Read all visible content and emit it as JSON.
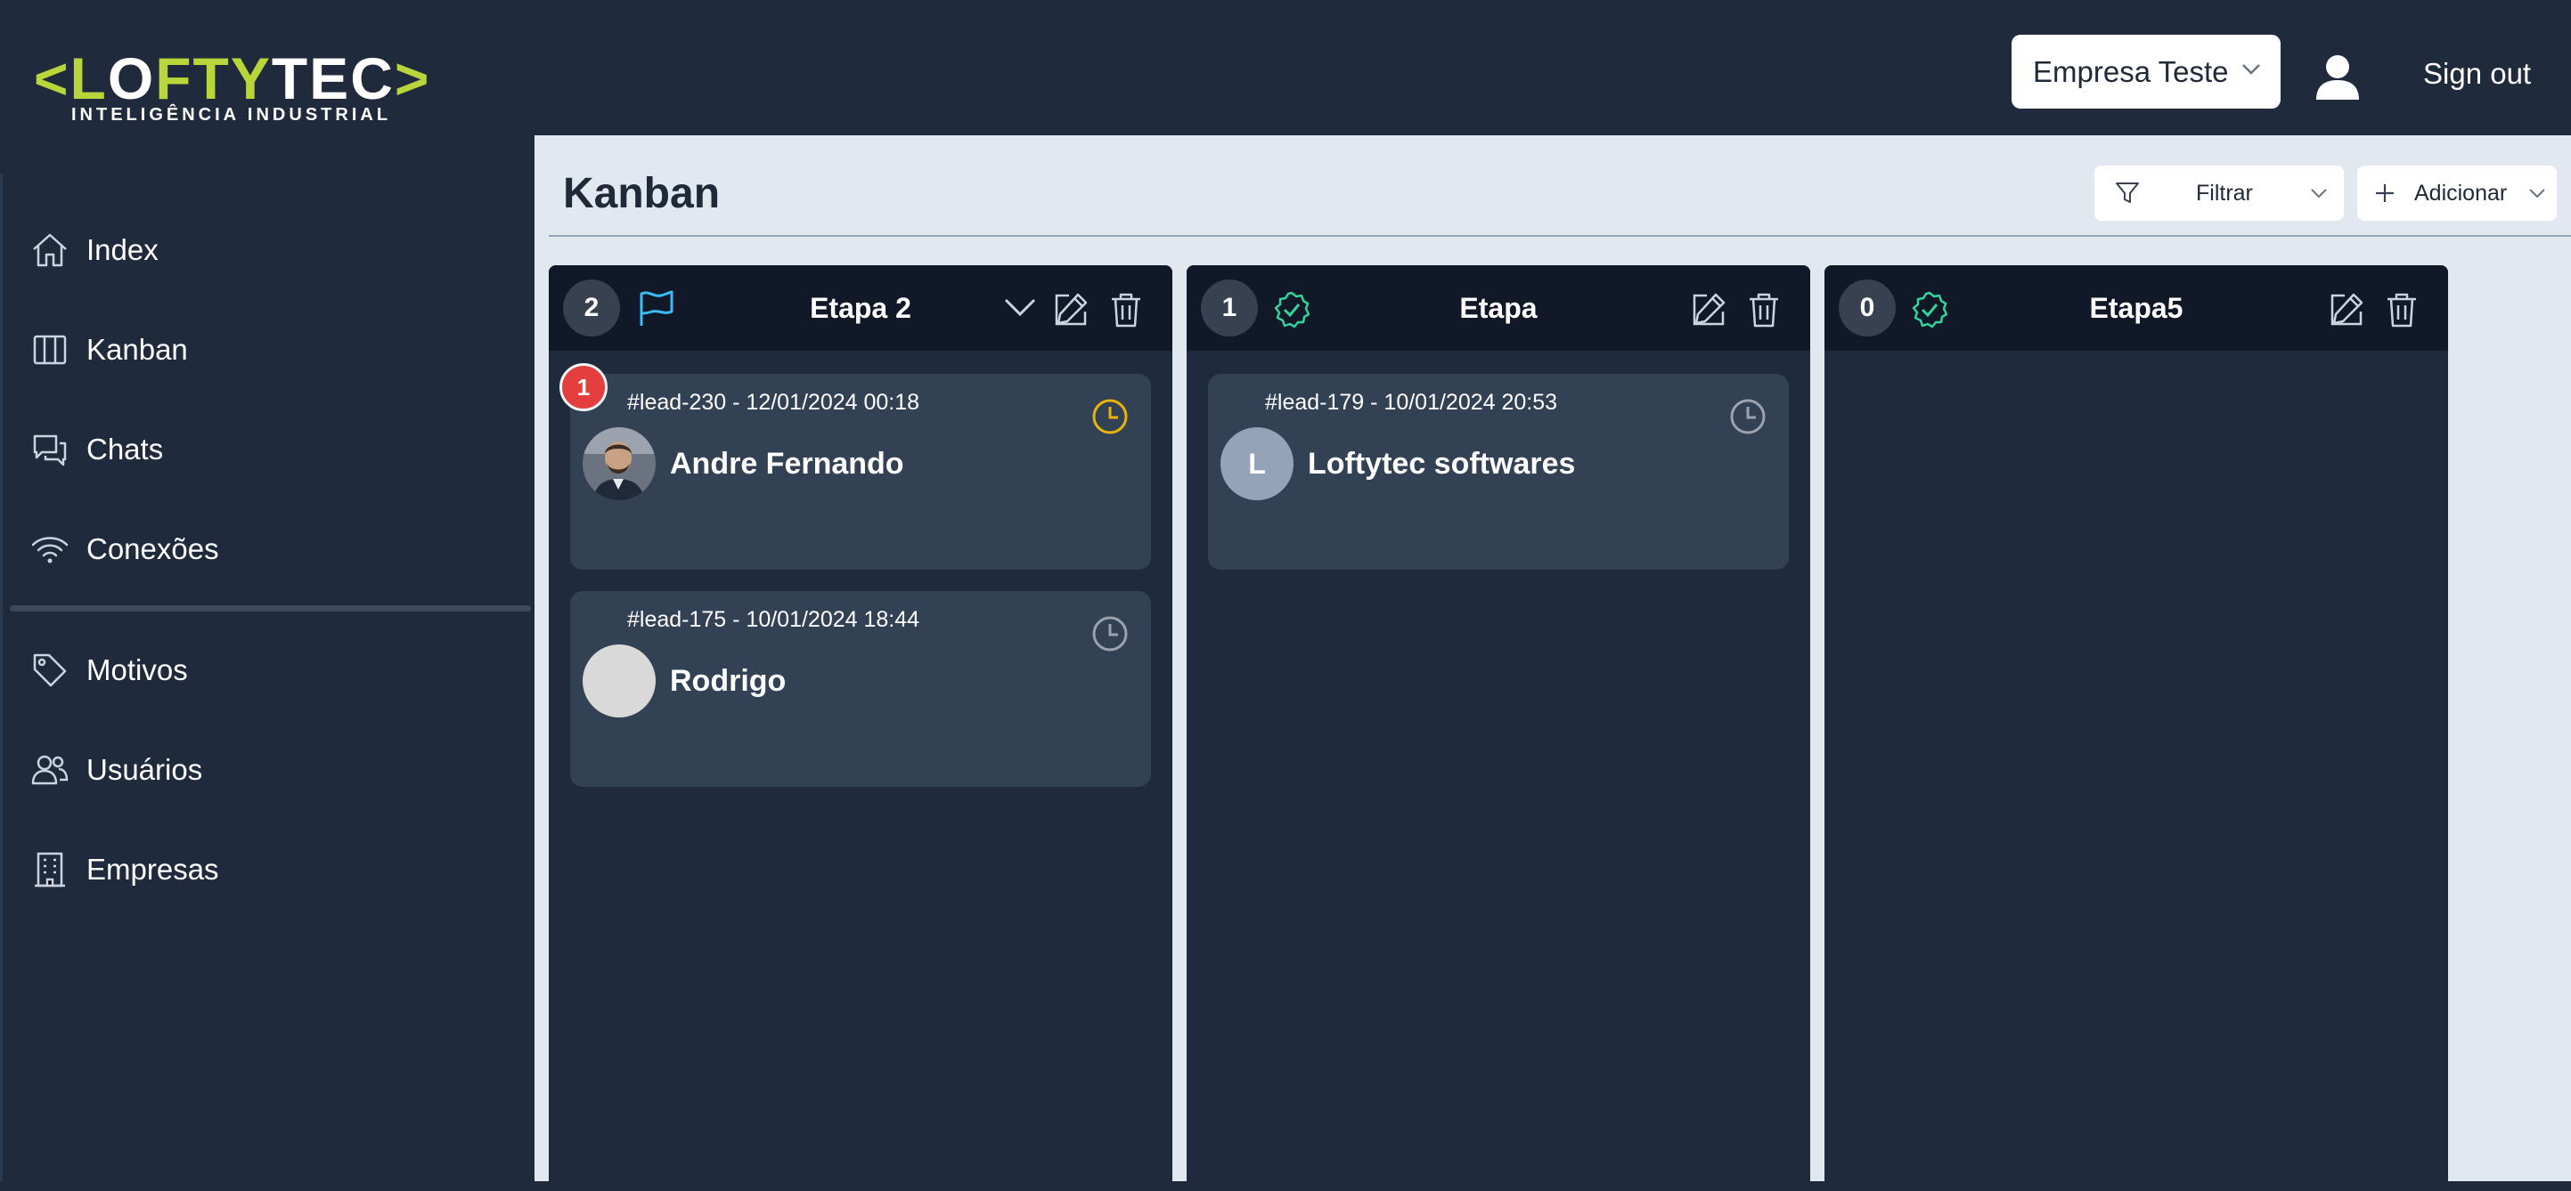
{
  "brand": {
    "logo_green_left": "<L",
    "logo_white_o": "O",
    "logo_green_mid": "FTY",
    "logo_white_tec": "TEC",
    "logo_green_right": ">",
    "tagline": "INTELIGÊNCIA INDUSTRIAL",
    "accent": "#b8d63a"
  },
  "header": {
    "company_selected": "Empresa Teste",
    "signout": "Sign out"
  },
  "sidebar": {
    "items": [
      {
        "label": "Index",
        "icon": "home-icon"
      },
      {
        "label": "Kanban",
        "icon": "columns-icon"
      },
      {
        "label": "Chats",
        "icon": "chat-icon"
      },
      {
        "label": "Conexões",
        "icon": "wifi-icon"
      },
      {
        "label": "Motivos",
        "icon": "tag-icon"
      },
      {
        "label": "Usuários",
        "icon": "users-icon"
      },
      {
        "label": "Empresas",
        "icon": "building-icon"
      }
    ]
  },
  "main": {
    "title": "Kanban",
    "filter_label": "Filtrar",
    "add_label": "Adicionar",
    "columns": [
      {
        "count": "2",
        "title": "Etapa 2",
        "icon": "flag-icon",
        "cards": [
          {
            "id_line": "#lead-230 - 12/01/2024 00:18",
            "name": "Andre Fernando",
            "notification": "1",
            "clock_color": "#eab308"
          },
          {
            "id_line": "#lead-175 - 10/01/2024 18:44",
            "name": "Rodrigo",
            "clock_color": "#9ca3af"
          }
        ]
      },
      {
        "count": "1",
        "title": "Etapa",
        "icon": "check-badge-icon",
        "cards": [
          {
            "id_line": "#lead-179 - 10/01/2024 20:53",
            "name": "Loftytec softwares",
            "avatar_letter": "L",
            "clock_color": "#9ca3af"
          }
        ]
      },
      {
        "count": "0",
        "title": "Etapa5",
        "icon": "check-badge-icon",
        "cards": []
      }
    ]
  }
}
